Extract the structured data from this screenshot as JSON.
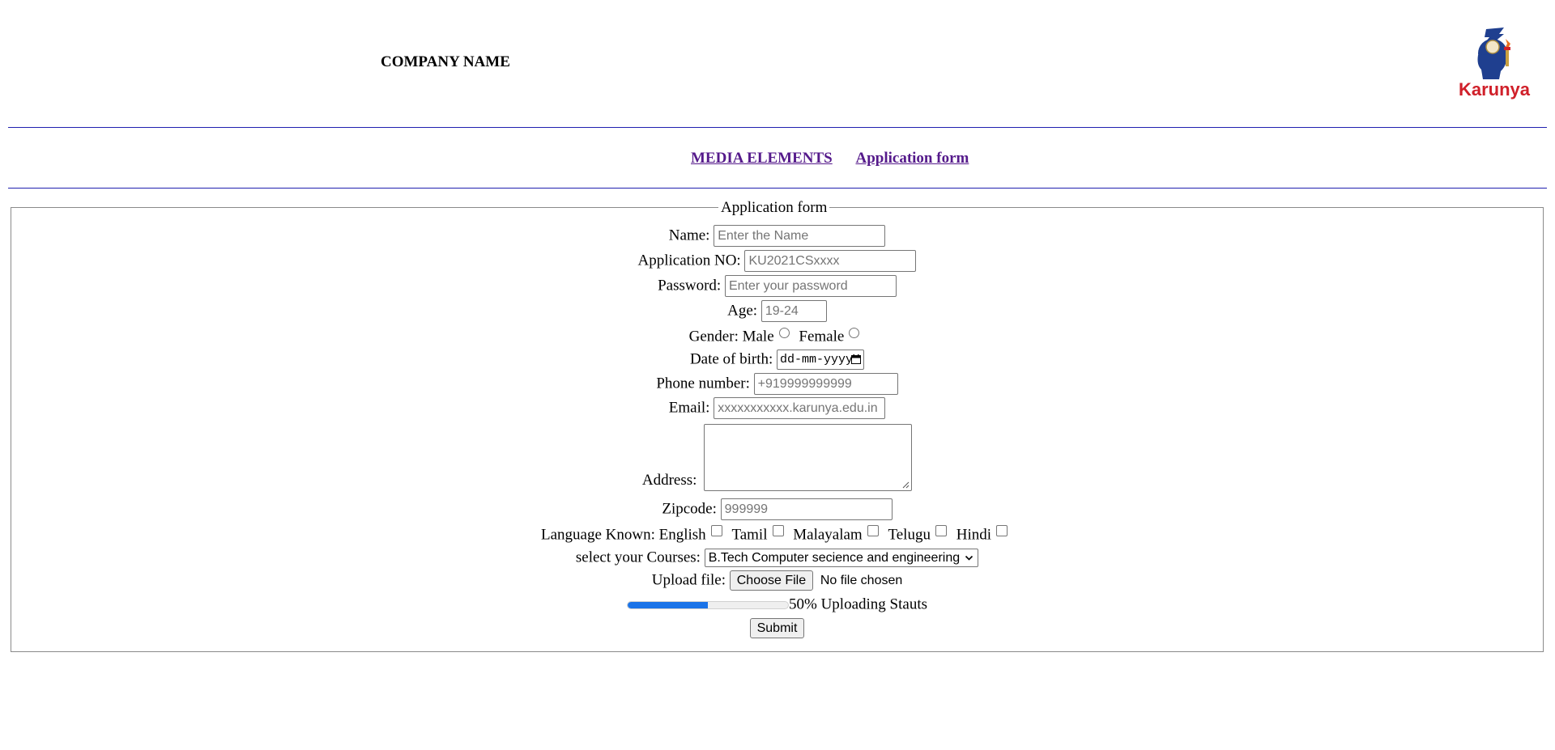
{
  "header": {
    "company_name": "COMPANY NAME",
    "logo_text": "Karunya"
  },
  "nav": {
    "links": [
      "MEDIA ELEMENTS",
      "Application form"
    ]
  },
  "form": {
    "legend": "Application form",
    "name": {
      "label": "Name:",
      "placeholder": "Enter the Name"
    },
    "application_no": {
      "label": "Application NO:",
      "placeholder": "KU2021CSxxxx"
    },
    "password": {
      "label": "Password:",
      "placeholder": "Enter your password"
    },
    "age": {
      "label": "Age:",
      "placeholder": "19-24"
    },
    "gender": {
      "label": "Gender:",
      "options": [
        "Male",
        "Female"
      ]
    },
    "dob": {
      "label": "Date of birth:",
      "value": "dd-mm-yyyy"
    },
    "phone": {
      "label": "Phone number:",
      "placeholder": "+919999999999"
    },
    "email": {
      "label": "Email:",
      "placeholder": "xxxxxxxxxxx.karunya.edu.in"
    },
    "address": {
      "label": "Address:"
    },
    "zipcode": {
      "label": "Zipcode:",
      "placeholder": "999999"
    },
    "languages": {
      "label": "Language Known:",
      "options": [
        "English",
        "Tamil",
        "Malayalam",
        "Telugu",
        "Hindi"
      ]
    },
    "courses": {
      "label": "select your Courses:",
      "selected": "B.Tech Computer secience and engineering"
    },
    "upload": {
      "label": "Upload file:",
      "button": "Choose File",
      "status": "No file chosen"
    },
    "progress": {
      "value": 0.5,
      "text": "50% Uploading Stauts"
    },
    "submit": "Submit"
  },
  "colors": {
    "rule": "#2020b0",
    "link_visited": "#551a8b",
    "progress_fill": "#1a73e8",
    "logo_blue": "#1f3f8f",
    "logo_red": "#d0202a"
  }
}
